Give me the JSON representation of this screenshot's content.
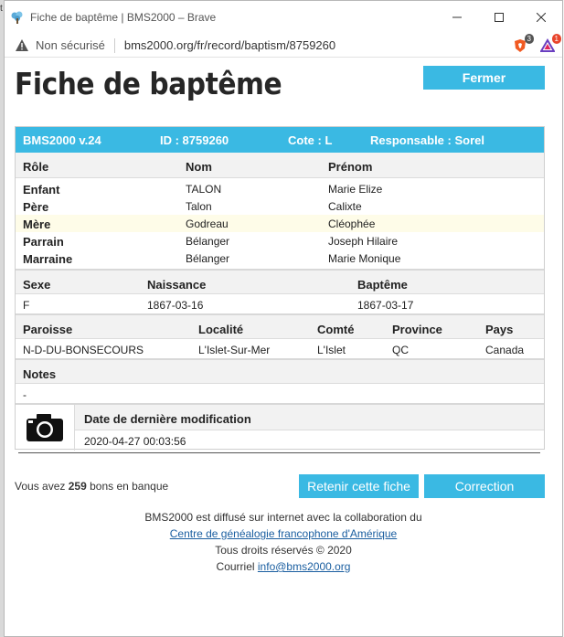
{
  "window": {
    "title": "Fiche de baptême | BMS2000 – Brave",
    "security_label": "Non sécurisé",
    "url": "bms2000.org/fr/record/baptism/8759260",
    "brave_badge": "3",
    "rewards_badge": "1"
  },
  "page": {
    "title": "Fiche de baptême",
    "close_label": "Fermer"
  },
  "record": {
    "version": "BMS2000 v.24",
    "id": "ID : 8759260",
    "cote": "Cote : L",
    "responsable": "Responsable : Sorel",
    "people_headers": [
      "Rôle",
      "Nom",
      "Prénom"
    ],
    "people": [
      {
        "role": "Enfant",
        "nom": "TALON",
        "prenom": "Marie Elize"
      },
      {
        "role": "Père",
        "nom": "Talon",
        "prenom": "Calixte"
      },
      {
        "role": "Mère",
        "nom": "Godreau",
        "prenom": "Cléophée"
      },
      {
        "role": "Parrain",
        "nom": "Bélanger",
        "prenom": "Joseph Hilaire"
      },
      {
        "role": "Marraine",
        "nom": "Bélanger",
        "prenom": "Marie Monique"
      }
    ],
    "dates_headers": [
      "Sexe",
      "Naissance",
      "Baptême"
    ],
    "dates_values": [
      "F",
      "1867-03-16",
      "1867-03-17"
    ],
    "place_headers": [
      "Paroisse",
      "Localité",
      "Comté",
      "Province",
      "Pays"
    ],
    "place_values": [
      "N-D-DU-BONSECOURS",
      "L'Islet-Sur-Mer",
      "L'Islet",
      "QC",
      "Canada"
    ],
    "notes_header": "Notes",
    "notes_value": "-",
    "modified_header": "Date de dernière modification",
    "modified_value": "2020-04-27 00:03:56"
  },
  "bank": {
    "prefix": "Vous avez",
    "count": "259",
    "suffix": "bons en banque"
  },
  "actions": {
    "keep_label": "Retenir cette fiche",
    "correction_label": "Correction"
  },
  "footer": {
    "line1": "BMS2000 est diffusé sur internet avec la collaboration du",
    "link1": "Centre de généalogie francophone d'Amérique",
    "line3": "Tous droits réservés © 2020",
    "line4_prefix": "Courriel",
    "email": "info@bms2000.org"
  },
  "colors": {
    "accent": "#3ab9e3",
    "highlight_row": "#fefce8",
    "link": "#1a5ea0"
  }
}
